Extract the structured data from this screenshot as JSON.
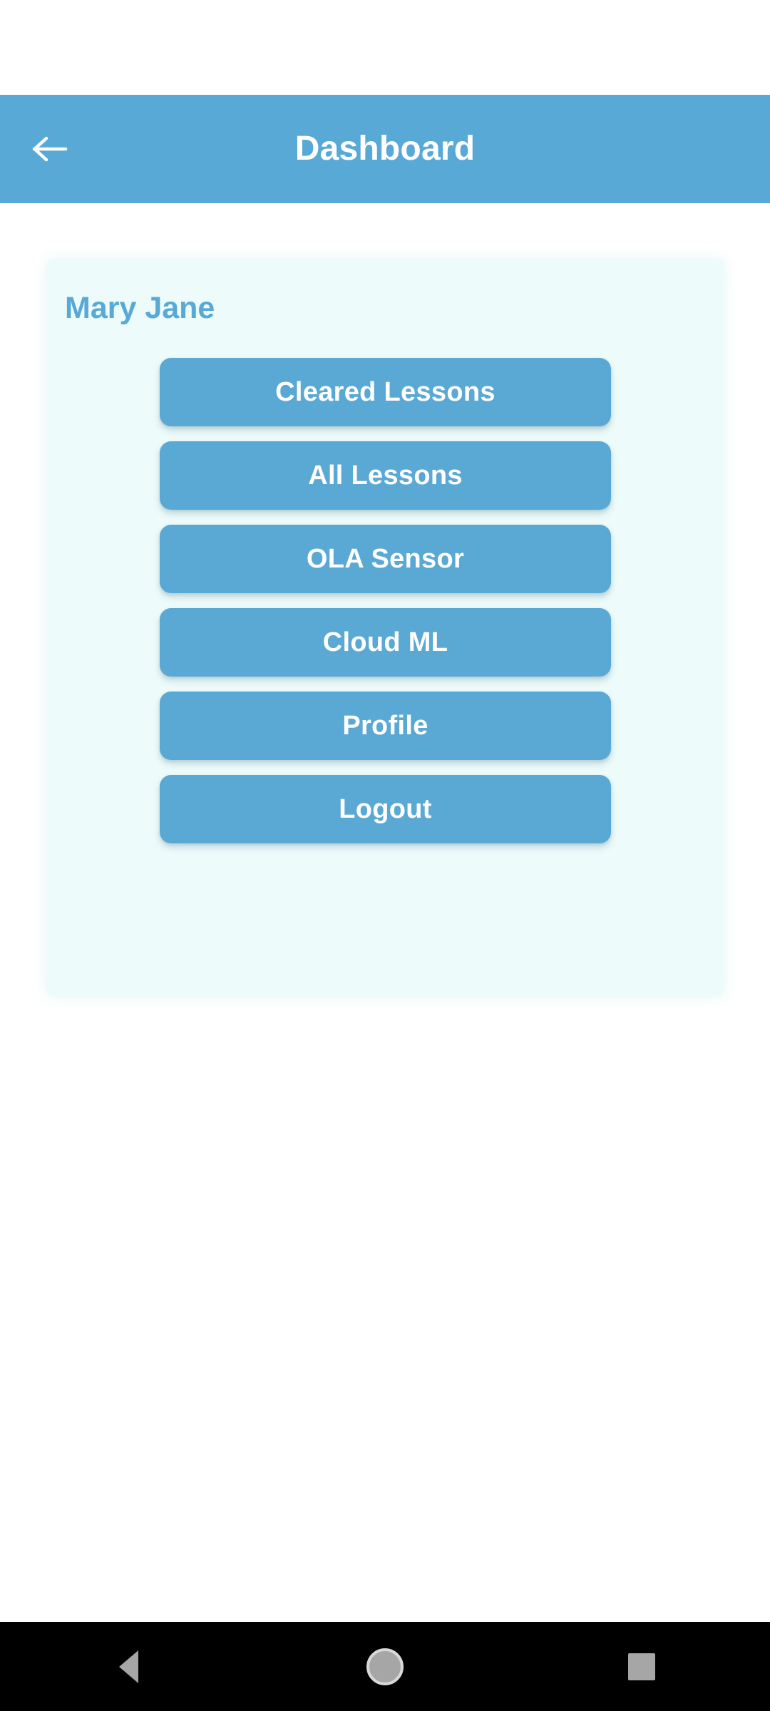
{
  "app_bar": {
    "title": "Dashboard",
    "back_icon": "arrow-left-icon",
    "background_color": "#58a9d6",
    "title_color": "#ffffff"
  },
  "card": {
    "user_name": "Mary Jane",
    "background_color": "#edfbfa",
    "user_name_color": "#58a9d6",
    "buttons": [
      {
        "label": "Cleared Lessons"
      },
      {
        "label": "All Lessons"
      },
      {
        "label": "OLA Sensor"
      },
      {
        "label": "Cloud ML"
      },
      {
        "label": "Profile"
      },
      {
        "label": "Logout"
      }
    ],
    "button_color": "#5aa8d4",
    "button_text_color": "#ffffff"
  },
  "nav_bar": {
    "background_color": "#000000",
    "icon_color": "#a6a6a6",
    "buttons": [
      {
        "name": "back",
        "icon": "triangle-left-icon"
      },
      {
        "name": "home",
        "icon": "circle-icon"
      },
      {
        "name": "recents",
        "icon": "square-icon"
      }
    ]
  }
}
